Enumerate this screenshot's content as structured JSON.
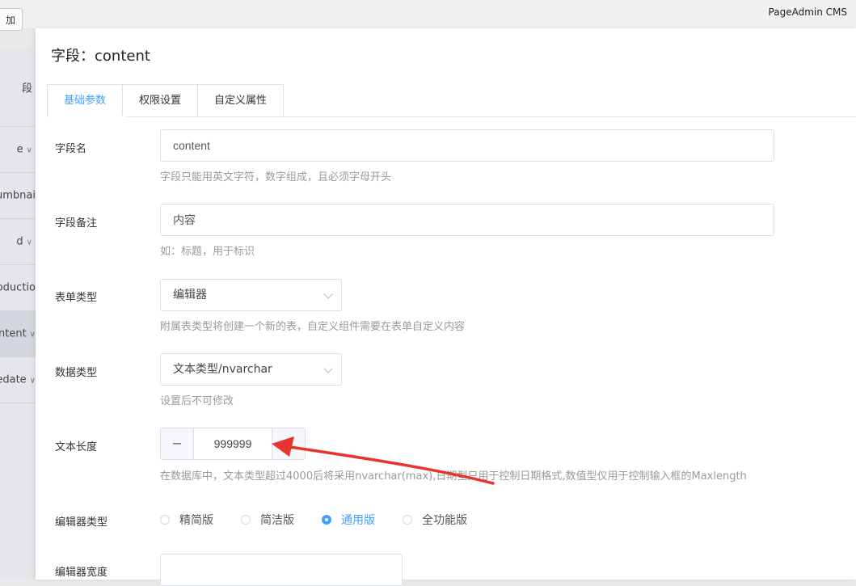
{
  "app": {
    "brand": "PageAdmin CMS",
    "add_button_label": "加"
  },
  "sidebar": {
    "items": [
      {
        "label": "段",
        "chevron": false,
        "active": false
      },
      {
        "label": "e",
        "chevron": true,
        "active": false
      },
      {
        "label": "umbnai",
        "chevron": false,
        "active": false
      },
      {
        "label": "d",
        "chevron": true,
        "active": false
      },
      {
        "label": "roductio",
        "chevron": false,
        "active": false
      },
      {
        "label": "ntent",
        "chevron": true,
        "active": true
      },
      {
        "label": "edate",
        "chevron": true,
        "active": false
      }
    ]
  },
  "dialog": {
    "title": "字段：content",
    "tabs": [
      {
        "label": "基础参数",
        "active": true
      },
      {
        "label": "权限设置",
        "active": false
      },
      {
        "label": "自定义属性",
        "active": false
      }
    ],
    "fields": {
      "field_name": {
        "label": "字段名",
        "value": "content",
        "hint": "字段只能用英文字符，数字组成，且必须字母开头"
      },
      "field_note": {
        "label": "字段备注",
        "value": "内容",
        "hint": "如：标题，用于标识"
      },
      "form_type": {
        "label": "表单类型",
        "value": "编辑器",
        "hint": "附属表类型将创建一个新的表，自定义组件需要在表单自定义内容"
      },
      "data_type": {
        "label": "数据类型",
        "value": "文本类型/nvarchar",
        "hint": "设置后不可修改"
      },
      "text_length": {
        "label": "文本长度",
        "value": "999999",
        "minus": "−",
        "plus": "+",
        "hint": "在数据库中，文本类型超过4000后将采用nvarchar(max),日期型只用于控制日期格式,数值型仅用于控制输入框的Maxlength"
      },
      "editor_type": {
        "label": "编辑器类型",
        "options": [
          {
            "label": "精简版",
            "checked": false
          },
          {
            "label": "简洁版",
            "checked": false
          },
          {
            "label": "通用版",
            "checked": true
          },
          {
            "label": "全功能版",
            "checked": false
          }
        ]
      },
      "editor_width": {
        "label": "编辑器宽度",
        "value": ""
      }
    }
  },
  "colors": {
    "accent": "#409eff",
    "annotation_arrow": "#e8342f"
  }
}
